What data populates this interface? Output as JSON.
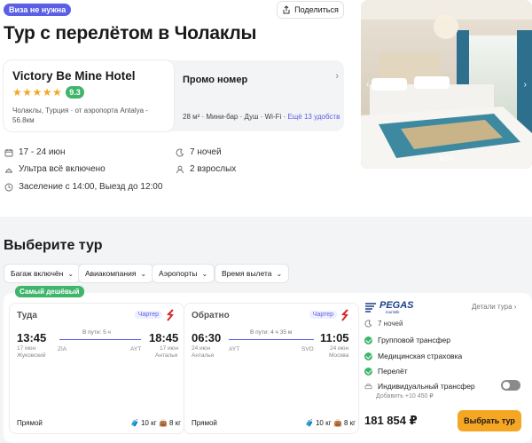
{
  "header": {
    "visa_badge": "Виза не нужна",
    "share_label": "Поделиться",
    "title": "Тур с перелётом в Чолаклы"
  },
  "hotel": {
    "name": "Victory Be Mine Hotel",
    "stars": "★★★★★",
    "score": "9.3",
    "location_line1": "Чолаклы, Турция · от аэропорта Antalya -",
    "location_line2": "56.8км"
  },
  "room": {
    "title": "Промо номер",
    "amenities": "28 м² · Мини-бар · Душ · Wi-Fi · ",
    "more": "Ещё 13 удобств"
  },
  "info": {
    "dates": "17 - 24 июн",
    "meal": "Ультра всё включено",
    "checkin": "Заселение с 14:00, Выезд до 12:00",
    "nights": "7 ночей",
    "guests": "2 взрослых"
  },
  "photo": {
    "counter": "4/34"
  },
  "tours": {
    "title": "Выберите тур",
    "filters": [
      "Багаж включён",
      "Авиакомпания",
      "Аэропорты",
      "Время вылета"
    ],
    "cheapest_badge": "Самый дешёвый"
  },
  "flight_out": {
    "title": "Туда",
    "charter": "Чартер",
    "dep_time": "13:45",
    "arr_time": "18:45",
    "duration": "В пути: 5 ч",
    "dep_code": "ZIA",
    "arr_code": "AYT",
    "dep_date": "17 июн",
    "dep_place": "Жуковский",
    "arr_date": "17 июн",
    "arr_place": "Анталья",
    "direct": "Прямой",
    "bag1": "10 кг",
    "bag2": "8 кг"
  },
  "flight_back": {
    "title": "Обратно",
    "charter": "Чартер",
    "dep_time": "06:30",
    "arr_time": "11:05",
    "duration": "В пути: 4 ч 35 м",
    "dep_code": "AYT",
    "arr_code": "SVO",
    "dep_date": "24 июн",
    "dep_place": "Анталья",
    "arr_date": "24 июн",
    "arr_place": "Москва",
    "direct": "Прямой",
    "bag1": "10 кг",
    "bag2": "8 кг"
  },
  "operator": {
    "name": "PEGAS",
    "tagline": "touristik",
    "details": "Детали тура",
    "nights": "7 ночей",
    "features": [
      "Групповой трансфер",
      "Медицинская страховка",
      "Перелёт"
    ],
    "individual_transfer": "Индивидуальный трансфер",
    "individual_add": "Добавить +10 450 ₽",
    "price": "181 854 ₽",
    "choose": "Выбрать тур"
  },
  "colors": {
    "accent": "#5b5fe6",
    "green": "#3fb56c",
    "orange": "#f5a623"
  }
}
